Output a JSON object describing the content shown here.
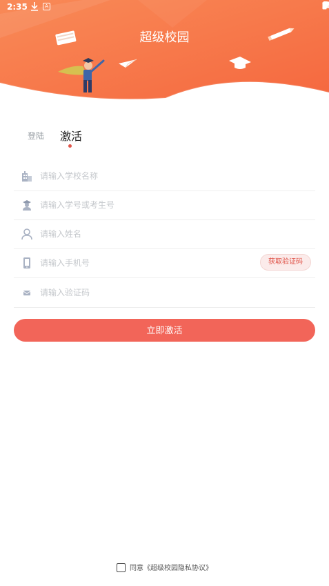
{
  "status_bar": {
    "time": "2:35",
    "badge": "A"
  },
  "header": {
    "title": "超级校园"
  },
  "tabs": [
    {
      "label": "登陆",
      "active": false
    },
    {
      "label": "激活",
      "active": true
    }
  ],
  "form": {
    "school": {
      "placeholder": "请输入学校名称",
      "value": ""
    },
    "student_id": {
      "placeholder": "请输入学号或考生号",
      "value": ""
    },
    "name": {
      "placeholder": "请输入姓名",
      "value": ""
    },
    "phone": {
      "placeholder": "请输入手机号",
      "value": ""
    },
    "code": {
      "placeholder": "请输入验证码",
      "value": ""
    },
    "get_code_label": "获取验证码",
    "submit_label": "立即激活"
  },
  "agreement": {
    "text": "同意《超级校园隐私协议》",
    "checked": false
  },
  "colors": {
    "primary": "#f26559",
    "header": "#f7734a",
    "accent": "#e0554a"
  }
}
